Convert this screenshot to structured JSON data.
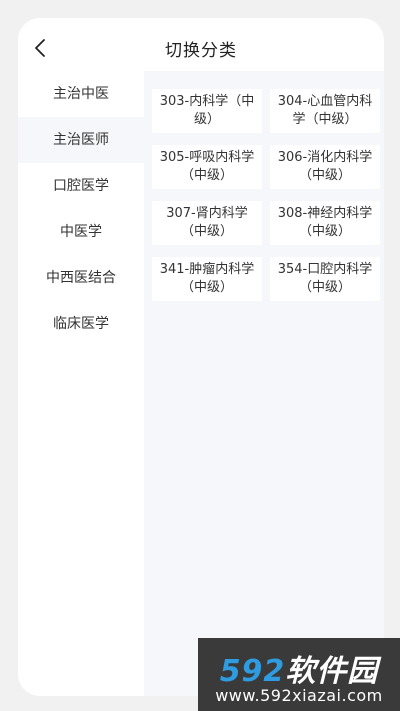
{
  "header": {
    "title": "切换分类",
    "back_icon": "chevron-left-icon"
  },
  "sidebar": {
    "items": [
      {
        "label": "主治中医",
        "active": false
      },
      {
        "label": "主治医师",
        "active": true
      },
      {
        "label": "口腔医学",
        "active": false
      },
      {
        "label": "中医学",
        "active": false
      },
      {
        "label": "中西医结合",
        "active": false
      },
      {
        "label": "临床医学",
        "active": false
      }
    ]
  },
  "content": {
    "cards": [
      {
        "label": "303-内科学（中级）"
      },
      {
        "label": "304-心血管内科学（中级）"
      },
      {
        "label": "305-呼吸内科学（中级）"
      },
      {
        "label": "306-消化内科学（中级）"
      },
      {
        "label": "307-肾内科学（中级）"
      },
      {
        "label": "308-神经内科学（中级）"
      },
      {
        "label": "341-肿瘤内科学（中级）"
      },
      {
        "label": "354-口腔内科学（中级）"
      }
    ]
  },
  "watermark": {
    "number": "592",
    "name": "软件园",
    "url": "www.592xiazai.com"
  },
  "colors": {
    "page_bg": "#f1f1f1",
    "content_bg": "#f6f7fb",
    "watermark_blue": "#2f9be0"
  }
}
